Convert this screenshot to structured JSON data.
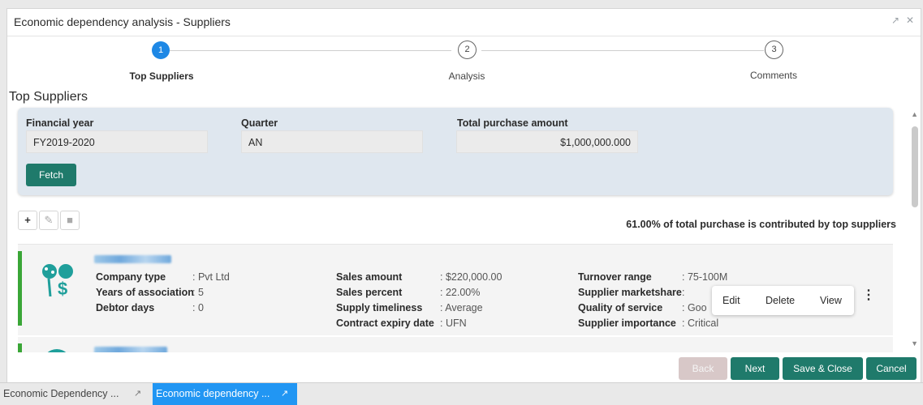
{
  "window": {
    "title": "Economic dependency analysis - Suppliers"
  },
  "stepper": {
    "steps": [
      {
        "number": "1",
        "label": "Top Suppliers",
        "state": "active"
      },
      {
        "number": "2",
        "label": "Analysis",
        "state": "inactive"
      },
      {
        "number": "3",
        "label": "Comments",
        "state": "inactive"
      }
    ]
  },
  "section": {
    "title": "Top Suppliers"
  },
  "filter": {
    "financial_year_label": "Financial year",
    "financial_year_value": "FY2019-2020",
    "quarter_label": "Quarter",
    "quarter_value": "AN",
    "total_purchase_label": "Total purchase amount",
    "total_purchase_value": "$1,000,000.000",
    "fetch_label": "Fetch"
  },
  "toolbar": {
    "icons": [
      "add-icon",
      "edit-icon",
      "delete-icon"
    ]
  },
  "summary": "61.00% of total purchase is contributed by top suppliers",
  "suppliers": [
    {
      "company_type_label": "Company type",
      "company_type": ": Pvt Ltd",
      "years_label": "Years of association",
      "years": ": 5",
      "debtor_label": "Debtor days",
      "debtor": ": 0",
      "sales_amount_label": "Sales amount",
      "sales_amount": ": $220,000.00",
      "sales_percent_label": "Sales percent",
      "sales_percent": ": 22.00%",
      "supply_label": "Supply timeliness",
      "supply": ": Average",
      "contract_label": "Contract expiry date",
      "contract": ": UFN",
      "turnover_label": "Turnover range",
      "turnover": ": 75-100M",
      "marketshare_label": "Supplier marketshare",
      "marketshare": ":",
      "quality_label": "Quality of service",
      "quality": ": Goo",
      "importance_label": "Supplier importance",
      "importance": ": Critical"
    }
  ],
  "context_menu": {
    "edit": "Edit",
    "delete": "Delete",
    "view": "View"
  },
  "footer": {
    "back": "Back",
    "next": "Next",
    "save_close": "Save & Close",
    "cancel": "Cancel"
  },
  "taskbar": {
    "items": [
      "Economic Dependency ...",
      "Economic dependency ..."
    ]
  },
  "colors": {
    "primary": "#1f7a6b",
    "step_active": "#1e88e5",
    "status_bar": "#3aa637",
    "task_active": "#2196f3"
  }
}
